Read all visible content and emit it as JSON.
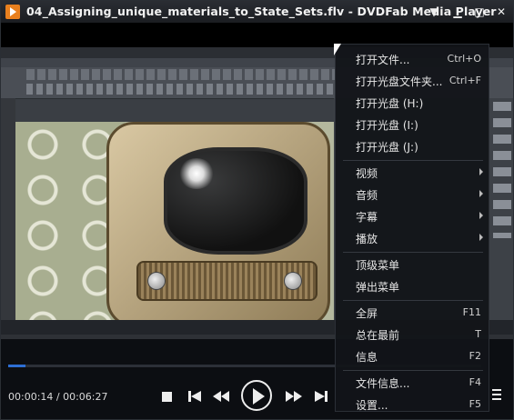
{
  "window": {
    "title": "04_Assigning_unique_materials_to_State_Sets.flv - DVDFab Media Player"
  },
  "player": {
    "time_display": "00:00:14 / 00:06:27",
    "progress": 0.036
  },
  "menu": {
    "items": [
      {
        "label": "打开文件...",
        "shortcut": "Ctrl+O"
      },
      {
        "label": "打开光盘文件夹...",
        "shortcut": "Ctrl+F"
      },
      {
        "label": "打开光盘 (H:)",
        "shortcut": ""
      },
      {
        "label": "打开光盘 (I:)",
        "shortcut": ""
      },
      {
        "label": "打开光盘 (J:)",
        "shortcut": ""
      },
      {
        "label": "视频",
        "shortcut": ""
      },
      {
        "label": "音频",
        "shortcut": ""
      },
      {
        "label": "字幕",
        "shortcut": ""
      },
      {
        "label": "播放",
        "shortcut": ""
      },
      {
        "label": "顶级菜单",
        "shortcut": ""
      },
      {
        "label": "弹出菜单",
        "shortcut": ""
      },
      {
        "label": "全屏",
        "shortcut": "F11"
      },
      {
        "label": "总在最前",
        "shortcut": "T"
      },
      {
        "label": "信息",
        "shortcut": "F2"
      },
      {
        "label": "文件信息...",
        "shortcut": "F4"
      },
      {
        "label": "设置...",
        "shortcut": "F5"
      }
    ]
  },
  "colors": {
    "accent": "#2d6ed3",
    "app_icon": "#e9801e"
  }
}
